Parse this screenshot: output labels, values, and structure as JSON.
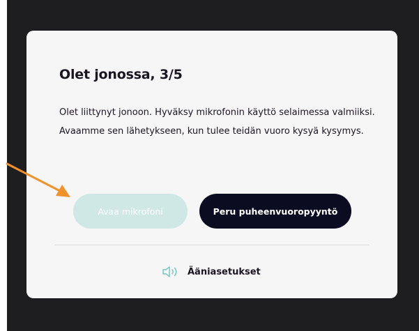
{
  "modal": {
    "title": "Olet jonossa, 3/5",
    "body": "Olet liittynyt jonoon. Hyväksy mikrofonin käyttö selaimessa valmiiksi. Avaamme sen lähetykseen, kun tulee teidän vuoro kysyä kysymys.",
    "open_mic_label": "Avaa mikrofoni",
    "cancel_label": "Peru puheenvuoropyyntö",
    "audio_settings_label": "Ääniasetukset"
  },
  "colors": {
    "background": "#1e1d1f",
    "modal_bg": "#f6f6f6",
    "text": "#1b1522",
    "mic_button_disabled": "#cfe8e6",
    "cancel_button": "#0b0c22",
    "speaker_icon": "#6fc2bf",
    "annotation_arrow": "#f0912b"
  },
  "icons": {
    "audio_settings": "speaker-icon",
    "annotation": "arrow-annotation"
  }
}
